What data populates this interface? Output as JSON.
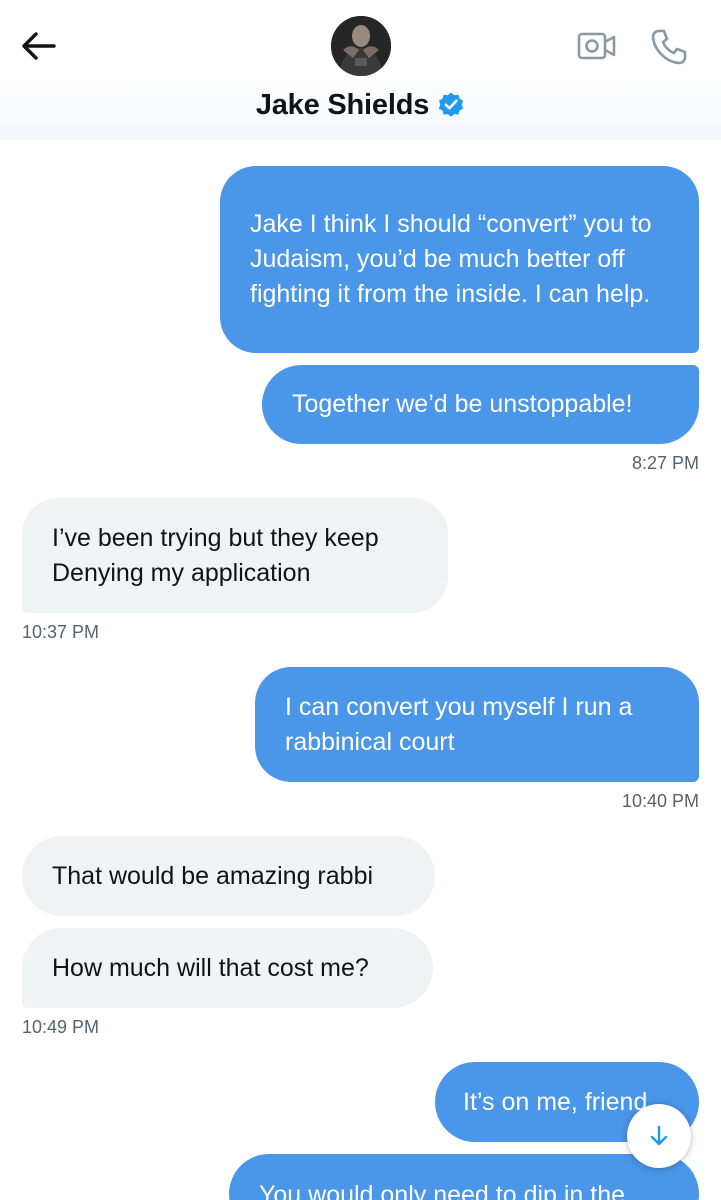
{
  "header": {
    "contact_name": "Jake Shields",
    "back_icon": "arrow-left-icon",
    "verified_icon": "verified-badge-icon",
    "video_icon": "video-camera-icon",
    "call_icon": "phone-icon"
  },
  "messages": [
    {
      "direction": "out",
      "text": "Jake I think I should “convert” you to Judaism, you’d be much better off fighting it from the inside. I can help."
    },
    {
      "direction": "out",
      "text": "Together we’d be unstoppable!",
      "time": "8:27 PM"
    },
    {
      "direction": "in",
      "text": "I’ve been trying but they keep Denying my application",
      "time": "10:37 PM"
    },
    {
      "direction": "out",
      "text": "I can convert you myself I run a rabbinical court",
      "time": "10:40 PM"
    },
    {
      "direction": "in",
      "text": "That would be amazing rabbi"
    },
    {
      "direction": "in",
      "text": "How much will that cost me?",
      "time": "10:49 PM"
    },
    {
      "direction": "out",
      "text": "It’s on me, friend"
    },
    {
      "direction": "out",
      "text": "You would only need to dip in the"
    }
  ],
  "scroll_button": {
    "icon": "arrow-down-icon"
  },
  "colors": {
    "outgoing_bubble": "#4a96e8",
    "incoming_bubble": "#eff3f4",
    "accent": "#1d9bf0",
    "timestamp": "#536471"
  }
}
